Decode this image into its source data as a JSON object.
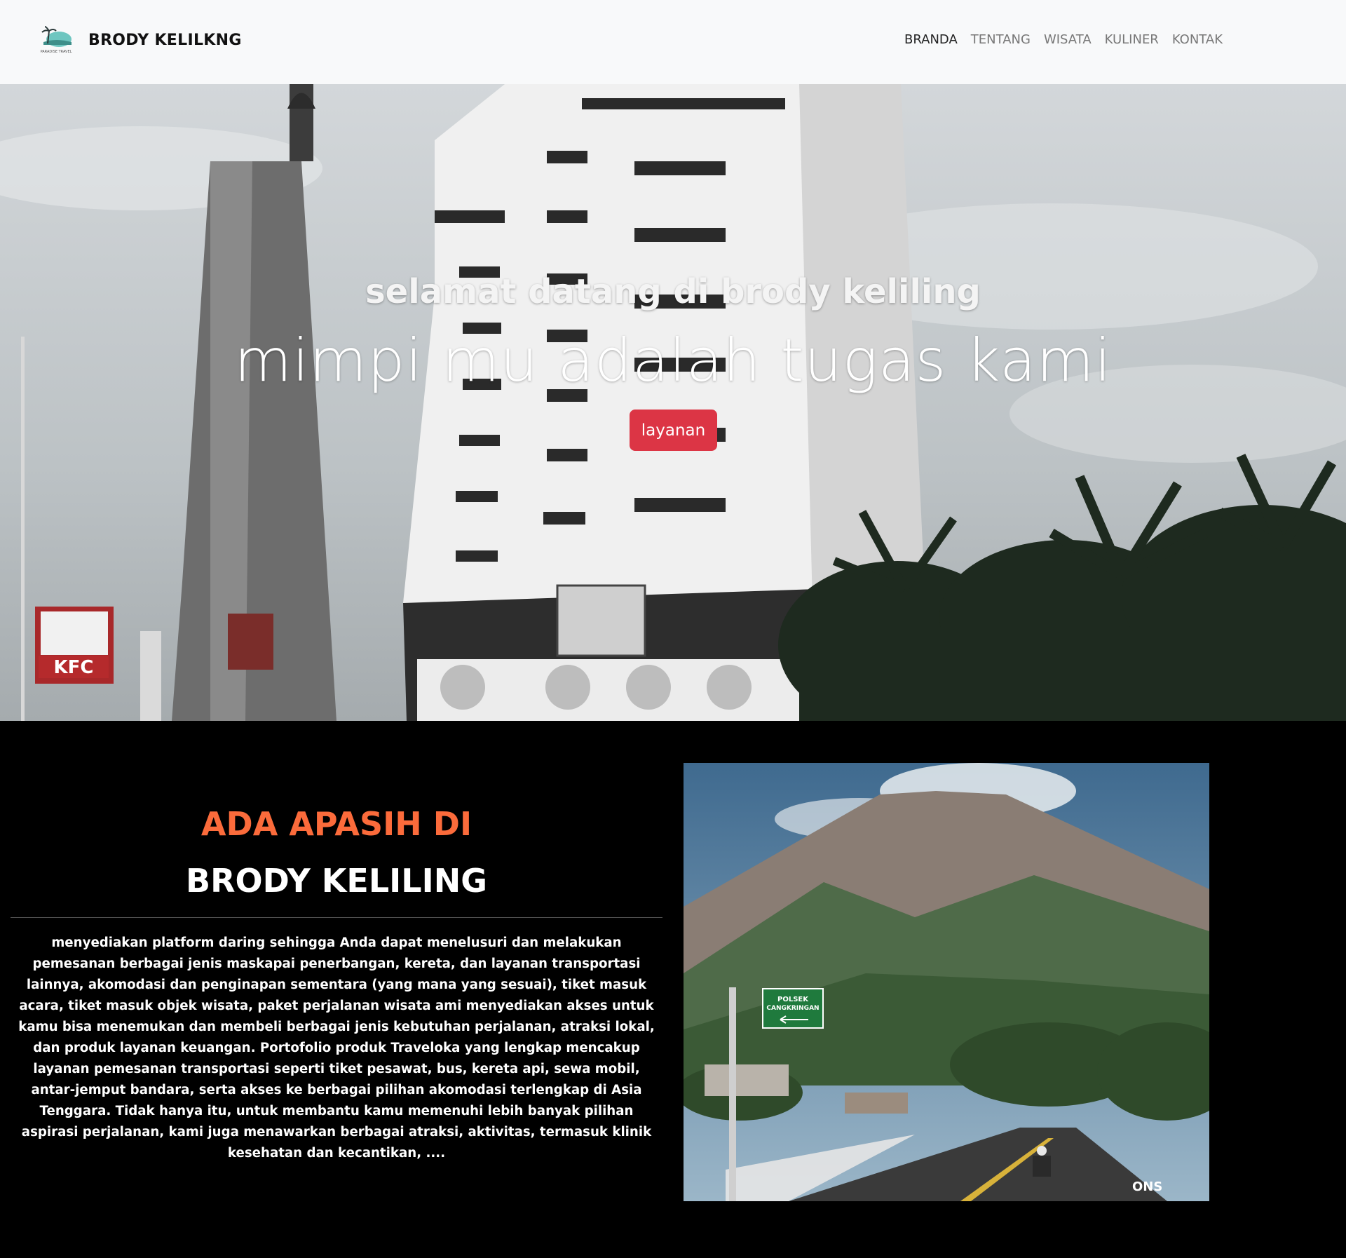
{
  "navbar": {
    "brand_name": "BRODY KELILKNG",
    "logo_text": "PARADISE TRAVEL",
    "links": [
      {
        "label": "BRANDA",
        "active": true
      },
      {
        "label": "TENTANG",
        "active": false
      },
      {
        "label": "WISATA",
        "active": false
      },
      {
        "label": "KULINER",
        "active": false
      },
      {
        "label": "KONTAK",
        "active": false
      }
    ]
  },
  "hero": {
    "subtitle": "selamat datang di brody keliling",
    "title": "mimpi mu adalah tugas kami",
    "button_label": "layanan",
    "button_color": "#dc3545",
    "kfc_sign": "KFC"
  },
  "about": {
    "heading_accent": "ADA APASIH DI",
    "heading_main": "BRODY KELILING",
    "accent_color": "#fb6b3b",
    "paragraph": "menyediakan platform daring sehingga Anda dapat menelusuri dan melakukan pemesanan berbagai jenis maskapai penerbangan, kereta, dan layanan transportasi lainnya, akomodasi dan penginapan sementara (yang mana yang sesuai), tiket masuk acara, tiket masuk objek wisata, paket perjalanan wisata ami menyediakan akses untuk kamu bisa menemukan dan membeli berbagai jenis kebutuhan perjalanan, atraksi lokal, dan produk layanan keuangan. Portofolio produk Traveloka yang lengkap mencakup layanan pemesanan transportasi seperti tiket pesawat, bus, kereta api, sewa mobil, antar-jemput bandara, serta akses ke berbagai pilihan akomodasi terlengkap di Asia Tenggara. Tidak hanya itu, untuk membantu kamu memenuhi lebih banyak pilihan aspirasi perjalanan, kami juga menawarkan berbagai atraksi, aktivitas, termasuk klinik kesehatan dan kecantikan, ....",
    "photo_sign_line1": "POLSEK",
    "photo_sign_line2": "CANGKRINGAN",
    "photo_watermark": "ONS"
  }
}
